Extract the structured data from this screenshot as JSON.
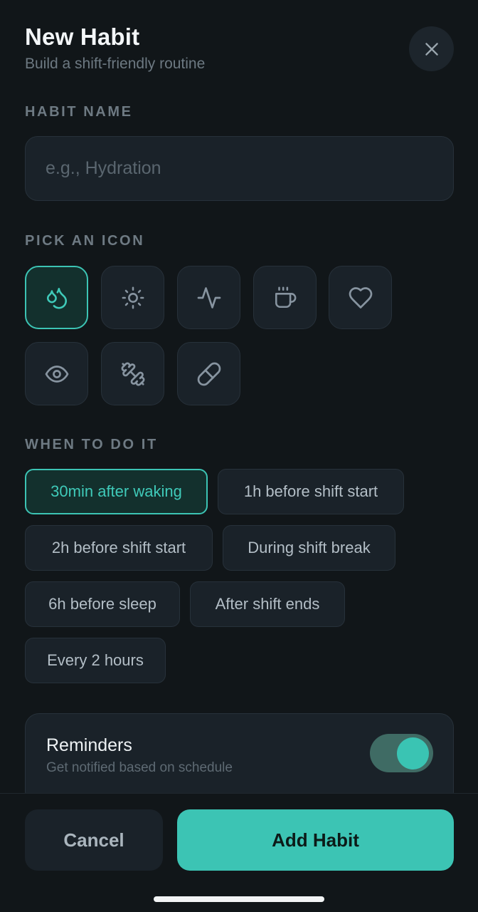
{
  "header": {
    "title": "New Habit",
    "subtitle": "Build a shift-friendly routine"
  },
  "habit_name": {
    "label": "HABIT NAME",
    "value": "",
    "placeholder": "e.g., Hydration"
  },
  "icons": {
    "label": "PICK AN ICON",
    "items": [
      "droplets",
      "sun",
      "activity",
      "coffee",
      "heart",
      "eye",
      "dumbbell",
      "pill"
    ],
    "selected": "droplets"
  },
  "timing": {
    "label": "WHEN TO DO IT",
    "options": [
      "30min after waking",
      "1h before shift start",
      "2h before shift start",
      "During shift break",
      "6h before sleep",
      "After shift ends",
      "Every 2 hours"
    ],
    "selected": "30min after waking"
  },
  "reminders": {
    "title": "Reminders",
    "subtitle": "Get notified based on schedule",
    "enabled": true
  },
  "actions": {
    "cancel_label": "Cancel",
    "add_label": "Add Habit"
  },
  "colors": {
    "accent": "#3cc4b4",
    "background": "#111619",
    "surface": "#1a2229"
  }
}
